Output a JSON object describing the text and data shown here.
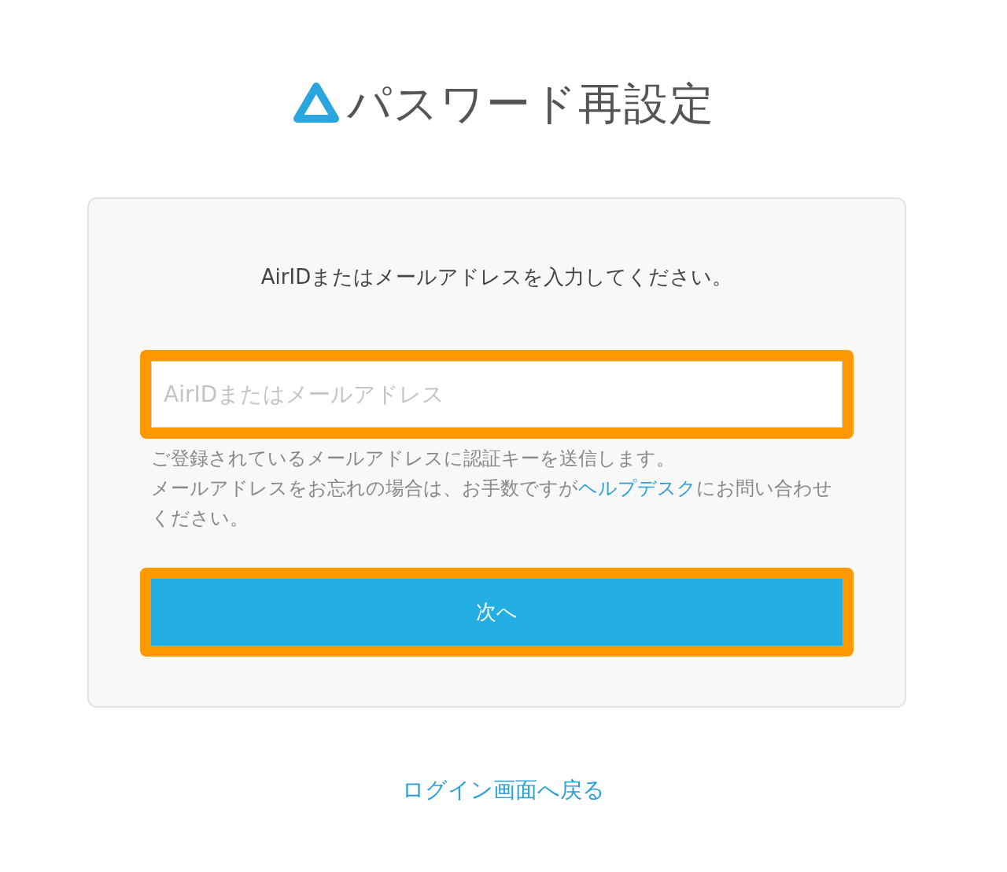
{
  "title": "パスワード再設定",
  "prompt": "AirIDまたはメールアドレスを入力してください。",
  "input": {
    "placeholder": "AirIDまたはメールアドレス",
    "highlighted": true
  },
  "help": {
    "line1": "ご登録されているメールアドレスに認証キーを送信します。",
    "line2_before": "メールアドレスをお忘れの場合は、お手数ですが",
    "link": "ヘルプデスク",
    "line2_after": "にお問い合わせください。"
  },
  "next_button": {
    "label": "次へ",
    "highlighted": true
  },
  "back_link": "ログイン画面へ戻る"
}
